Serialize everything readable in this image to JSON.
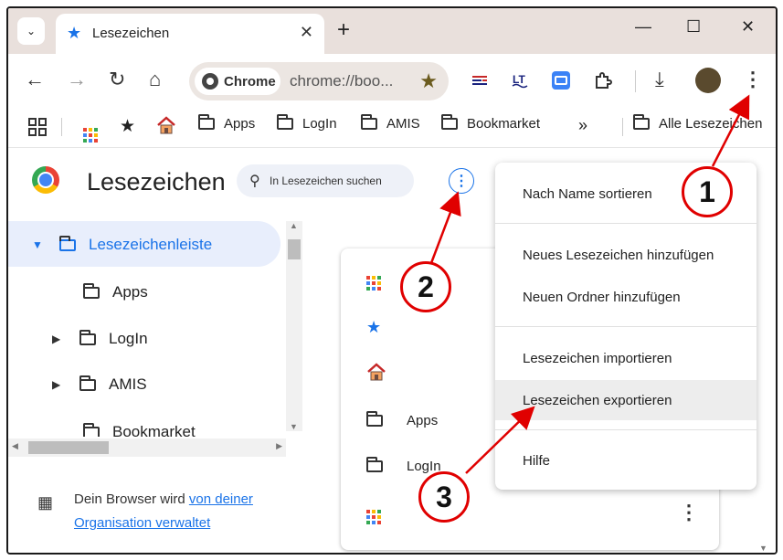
{
  "window": {
    "tab_title": "Lesezeichen",
    "tab_favicon": "star-icon",
    "new_tab": "+",
    "minimize": "—",
    "maximize": "☐",
    "close": "✕",
    "tab_close": "✕"
  },
  "toolbar": {
    "back": "←",
    "forward": "→",
    "reload": "↻",
    "home": "⌂",
    "chip_label": "Chrome",
    "url": "chrome://boo...",
    "star": "★",
    "download": "⤓",
    "menu": "⋮"
  },
  "bookmarks_bar": {
    "items": [
      {
        "label": "Apps"
      },
      {
        "label": "LogIn"
      },
      {
        "label": "AMIS"
      },
      {
        "label": "Bookmarket"
      }
    ],
    "overflow": "»",
    "all_bookmarks": "Alle Lesezeichen"
  },
  "page": {
    "title": "Lesezeichen",
    "search_placeholder": "In Lesezeichen suchen",
    "tree": [
      {
        "label": "Lesezeichenleiste",
        "selected": true
      },
      {
        "label": "Apps"
      },
      {
        "label": "LogIn"
      },
      {
        "label": "AMIS"
      },
      {
        "label": "Bookmarket"
      }
    ],
    "managed_text": "Dein Browser wird ",
    "managed_link": "von deiner Organisation verwaltet"
  },
  "list": {
    "rows": [
      {
        "label": ""
      },
      {
        "label": ""
      },
      {
        "label": ""
      },
      {
        "label": "Apps"
      },
      {
        "label": "LogIn"
      },
      {
        "label": ""
      }
    ]
  },
  "menu": {
    "items": [
      "Nach Name sortieren",
      "Neues Lesezeichen hinzufügen",
      "Neuen Ordner hinzufügen",
      "Lesezeichen importieren",
      "Lesezeichen exportieren",
      "Hilfe"
    ],
    "highlighted_index": 4
  },
  "callouts": [
    "1",
    "2",
    "3"
  ],
  "colors": {
    "accent": "#1a73e8",
    "callout_red": "#e00000",
    "tabstrip": "#e9e0dc",
    "selection": "#e8eefc"
  }
}
